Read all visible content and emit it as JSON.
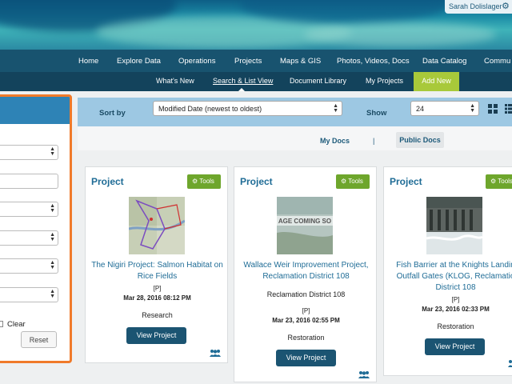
{
  "user": {
    "name": "Sarah Dolislager",
    "settings_icon": "gear-icon"
  },
  "main_nav": [
    "Home",
    "Explore Data",
    "Operations",
    "Projects",
    "Maps & GIS",
    "Photos, Videos, Docs",
    "Data Catalog",
    "Commu"
  ],
  "sub_nav": {
    "items": [
      "What's New",
      "Search & List View",
      "Document Library",
      "My Projects"
    ],
    "active": "Search & List View",
    "add_new": "Add New"
  },
  "filter_panel": {
    "clear_label": "Clear",
    "reset_label": "Reset"
  },
  "sort_bar": {
    "sort_label": "Sort by",
    "sort_value": "Modified Date (newest to oldest)",
    "show_label": "Show",
    "show_value": "24",
    "view_icons": [
      "grid-view-icon",
      "list-view-icon"
    ]
  },
  "docs_toggle": {
    "my_docs": "My Docs",
    "separator": "|",
    "public_docs": "Public Docs",
    "selected": "Public Docs"
  },
  "colors": {
    "nav": "#18536f",
    "subnav": "#13435c",
    "accent_green": "#a8c93a",
    "tools_green": "#6ea62c",
    "link_blue": "#1f6c96",
    "highlight": "#f07a2a"
  },
  "cards": [
    {
      "type": "Project",
      "tools": "Tools",
      "title": "The Nigiri Project: Salmon Habitat on Rice Fields",
      "flag": "[P]",
      "date": "Mar 28, 2016 08:12 PM",
      "category": "Research",
      "view": "View Project",
      "image": "map thumbnail"
    },
    {
      "type": "Project",
      "tools": "Tools",
      "title": "Wallace Weir Improvement Project, Reclamation District 108",
      "org": "Reclamation District 108",
      "flag": "[P]",
      "date": "Mar 23, 2016 02:55 PM",
      "category": "Restoration",
      "view": "View Project",
      "image_text": "AGE COMING SO"
    },
    {
      "type": "Project",
      "tools": "Tools",
      "title": "Fish Barrier at the Knights Landin Outfall Gates (KLOG, Reclamatio District 108",
      "flag": "[P]",
      "date": "Mar 23, 2016 02:33 PM",
      "category": "Restoration",
      "view": "View Project",
      "image": "dam photo"
    }
  ]
}
